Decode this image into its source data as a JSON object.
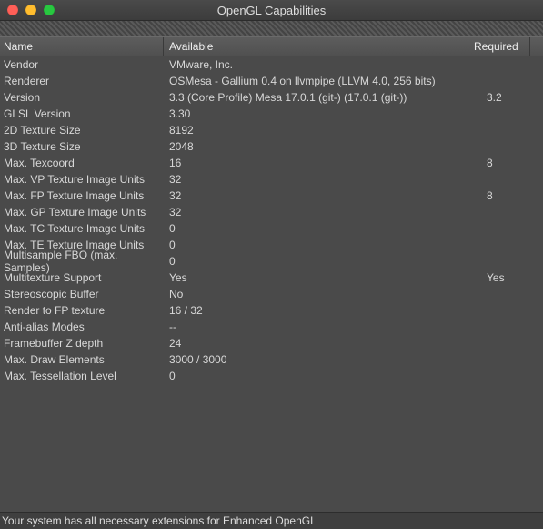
{
  "window": {
    "title": "OpenGL Capabilities"
  },
  "columns": {
    "name": "Name",
    "available": "Available",
    "required": "Required"
  },
  "rows": [
    {
      "name": "Vendor",
      "available": "VMware, Inc.",
      "required": ""
    },
    {
      "name": "Renderer",
      "available": "OSMesa - Gallium 0.4 on llvmpipe (LLVM 4.0, 256 bits)",
      "required": ""
    },
    {
      "name": "Version",
      "available": "3.3 (Core Profile) Mesa 17.0.1 (git-) (17.0.1 (git-))",
      "required": "3.2"
    },
    {
      "name": "GLSL Version",
      "available": "3.30",
      "required": ""
    },
    {
      "name": "2D Texture Size",
      "available": "8192",
      "required": ""
    },
    {
      "name": "3D Texture Size",
      "available": "2048",
      "required": ""
    },
    {
      "name": "Max. Texcoord",
      "available": "16",
      "required": "8"
    },
    {
      "name": "Max. VP Texture Image Units",
      "available": "32",
      "required": ""
    },
    {
      "name": "Max. FP Texture Image Units",
      "available": "32",
      "required": "8"
    },
    {
      "name": "Max. GP Texture Image Units",
      "available": "32",
      "required": ""
    },
    {
      "name": "Max. TC Texture Image Units",
      "available": "0",
      "required": ""
    },
    {
      "name": "Max. TE Texture Image Units",
      "available": "0",
      "required": ""
    },
    {
      "name": "Multisample FBO (max. Samples)",
      "available": "0",
      "required": ""
    },
    {
      "name": "Multitexture Support",
      "available": "Yes",
      "required": "Yes"
    },
    {
      "name": "Stereoscopic Buffer",
      "available": "No",
      "required": ""
    },
    {
      "name": "Render to FP texture",
      "available": "16 / 32",
      "required": ""
    },
    {
      "name": "Anti-alias Modes",
      "available": "--",
      "required": ""
    },
    {
      "name": "Framebuffer Z depth",
      "available": "24",
      "required": ""
    },
    {
      "name": "Max. Draw Elements",
      "available": "3000 / 3000",
      "required": ""
    },
    {
      "name": "Max. Tessellation Level",
      "available": "0",
      "required": ""
    }
  ],
  "status": "Your system has all necessary extensions for Enhanced OpenGL"
}
